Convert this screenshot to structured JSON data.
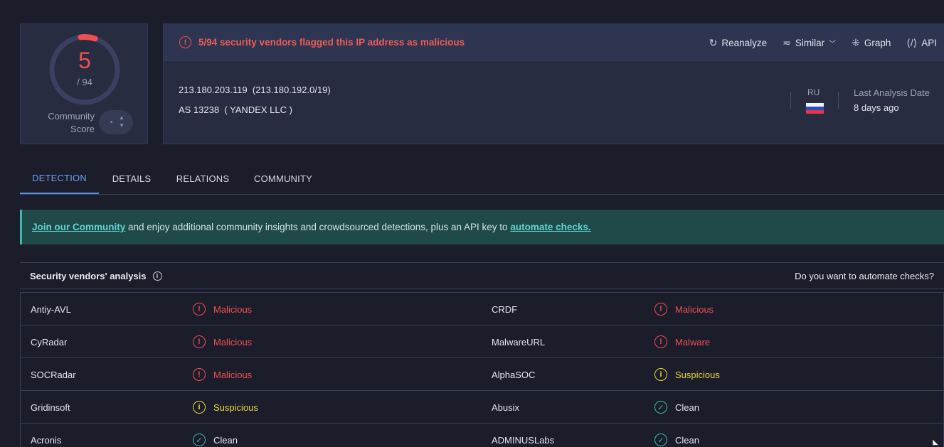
{
  "score": {
    "detections": "5",
    "total": "/ 94",
    "community_label_1": "Community",
    "community_label_2": "Score"
  },
  "header": {
    "alert": "5/94 security vendors flagged this IP address as malicious",
    "actions": [
      {
        "label": "Reanalyze",
        "icon": "refresh-icon"
      },
      {
        "label": "Similar",
        "icon": "similar-icon"
      },
      {
        "label": "Graph",
        "icon": "graph-icon"
      },
      {
        "label": "API",
        "icon": "api-icon"
      }
    ],
    "ip": "213.180.203.119",
    "network": "(213.180.192.0/19)",
    "asn": "AS 13238",
    "as_owner": "( YANDEX LLC )",
    "country_code": "RU",
    "last_analysis_label": "Last Analysis Date",
    "last_analysis_value": "8 days ago"
  },
  "tabs": [
    "DETECTION",
    "DETAILS",
    "RELATIONS",
    "COMMUNITY"
  ],
  "banner": {
    "link1": "Join our Community",
    "middle": " and enjoy additional community insights and crowdsourced detections, plus an API key to ",
    "link2": "automate checks."
  },
  "vendors": {
    "title": "Security vendors' analysis",
    "automate_question": "Do you want to automate checks?",
    "rows": [
      [
        {
          "vendor": "Antiy-AVL",
          "result": "Malicious",
          "status": "malicious"
        },
        {
          "vendor": "CRDF",
          "result": "Malicious",
          "status": "malicious"
        }
      ],
      [
        {
          "vendor": "CyRadar",
          "result": "Malicious",
          "status": "malicious"
        },
        {
          "vendor": "MalwareURL",
          "result": "Malware",
          "status": "malicious"
        }
      ],
      [
        {
          "vendor": "SOCRadar",
          "result": "Malicious",
          "status": "malicious"
        },
        {
          "vendor": "AlphaSOC",
          "result": "Suspicious",
          "status": "suspicious"
        }
      ],
      [
        {
          "vendor": "Gridinsoft",
          "result": "Suspicious",
          "status": "suspicious"
        },
        {
          "vendor": "Abusix",
          "result": "Clean",
          "status": "clean"
        }
      ],
      [
        {
          "vendor": "Acronis",
          "result": "Clean",
          "status": "clean"
        },
        {
          "vendor": "ADMINUSLabs",
          "result": "Clean",
          "status": "clean"
        }
      ]
    ]
  },
  "colors": {
    "malicious": "#ef4f4f",
    "suspicious": "#e8d83a",
    "clean": "#40b8a4",
    "accent": "#5b8ee6"
  }
}
